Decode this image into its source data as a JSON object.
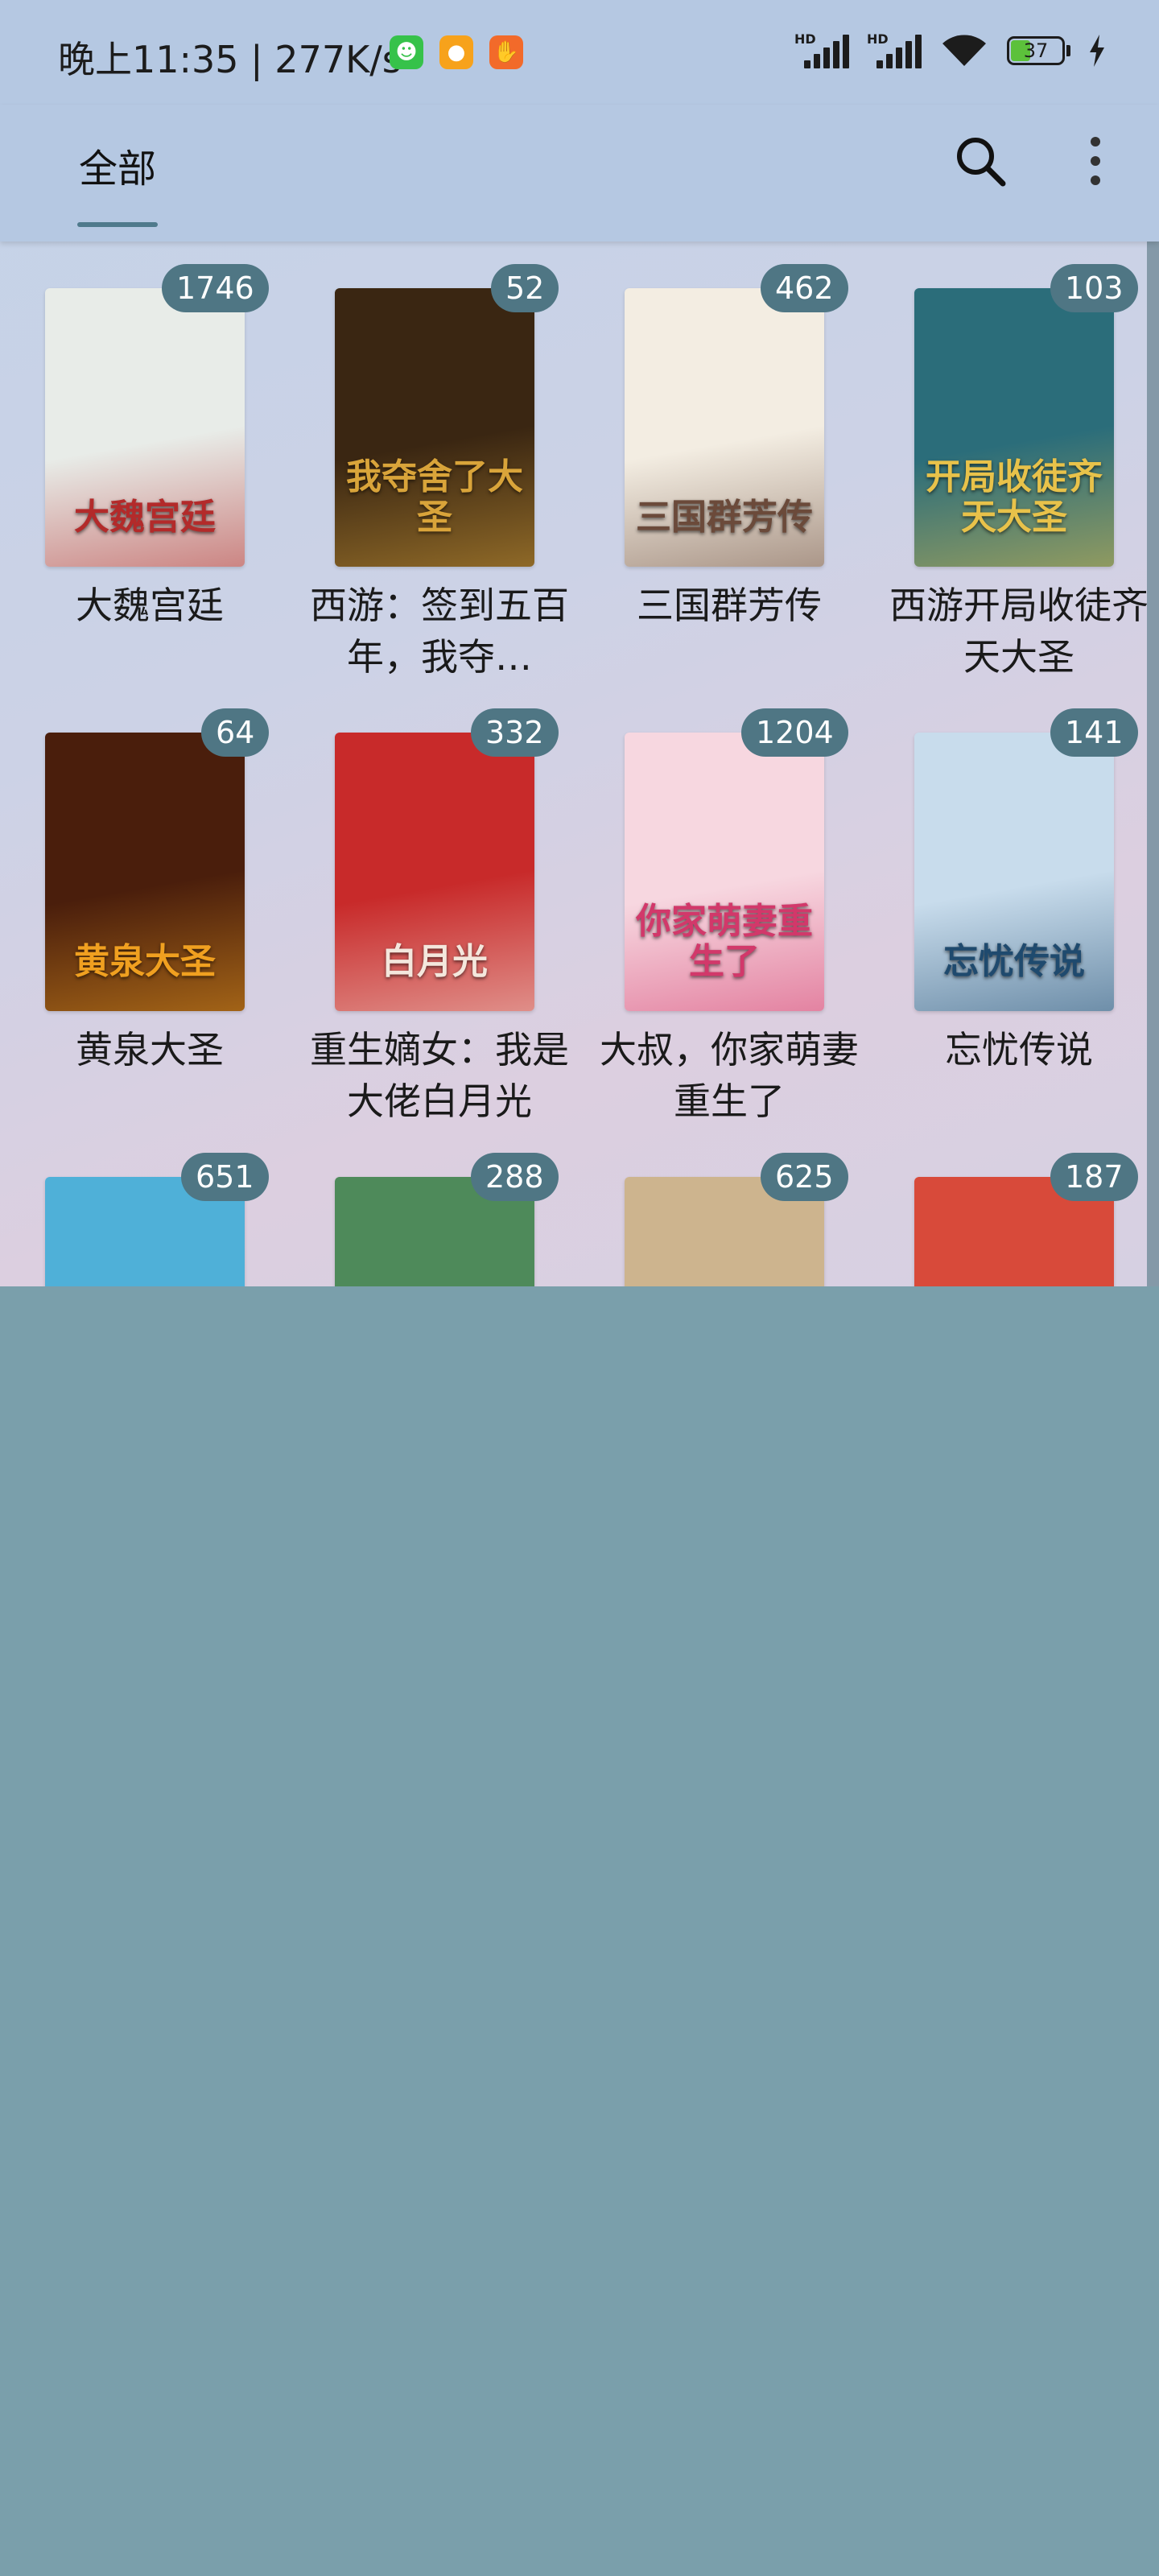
{
  "status_bar": {
    "time_speed": "晚上11:35 | 277K/s",
    "hd_label": "HD",
    "battery_level": "37",
    "icons": [
      "app-icon-green",
      "app-icon-orange",
      "app-icon-hand",
      "signal-icon",
      "signal-icon",
      "wifi-icon",
      "battery-icon",
      "charging-icon"
    ]
  },
  "toolbar": {
    "tab_label": "全部",
    "icons": [
      "search-icon",
      "more-vert-icon"
    ]
  },
  "books": [
    {
      "title": "大魏宫廷",
      "count": "1746",
      "cover_text": "大魏宫廷",
      "cover_color": "#e8ece8",
      "cover_accent": "#b32a2a"
    },
    {
      "title": "西游：签到五百年，我夺…",
      "count": "52",
      "cover_text": "我夺舍了大圣",
      "cover_color": "#3a2612",
      "cover_accent": "#d9a43a"
    },
    {
      "title": "三国群芳传",
      "count": "462",
      "cover_text": "三国群芳传",
      "cover_color": "#f3ede2",
      "cover_accent": "#6b4a3a"
    },
    {
      "title": "西游开局收徒齐天大圣",
      "count": "103",
      "cover_text": "开局收徒齐天大圣",
      "cover_color": "#2b6d7a",
      "cover_accent": "#e8c24a"
    },
    {
      "title": "黄泉大圣",
      "count": "64",
      "cover_text": "黄泉大圣",
      "cover_color": "#4a1e0c",
      "cover_accent": "#f0a020"
    },
    {
      "title": "重生嫡女：我是大佬白月光",
      "count": "332",
      "cover_text": "白月光",
      "cover_color": "#c82a2a",
      "cover_accent": "#f4e7dd"
    },
    {
      "title": "大叔，你家萌妻重生了",
      "count": "1204",
      "cover_text": "你家萌妻重生了",
      "cover_color": "#f7d7e0",
      "cover_accent": "#d2386a"
    },
    {
      "title": "忘忧传说",
      "count": "141",
      "cover_text": "忘忧传说",
      "cover_color": "#c8dcec",
      "cover_accent": "#1f4a6e"
    },
    {
      "title": "",
      "count": "651",
      "cover_text": "",
      "cover_color": "#4fb0d8",
      "cover_accent": "#f2c030"
    },
    {
      "title": "",
      "count": "288",
      "cover_text": "",
      "cover_color": "#4e8a5a",
      "cover_accent": "#a7d0b0"
    },
    {
      "title": "",
      "count": "625",
      "cover_text": "",
      "cover_color": "#cdb48e",
      "cover_accent": "#6a4a2a"
    },
    {
      "title": "",
      "count": "187",
      "cover_text": "",
      "cover_color": "#d84a3a",
      "cover_accent": "#f4a63a"
    }
  ]
}
